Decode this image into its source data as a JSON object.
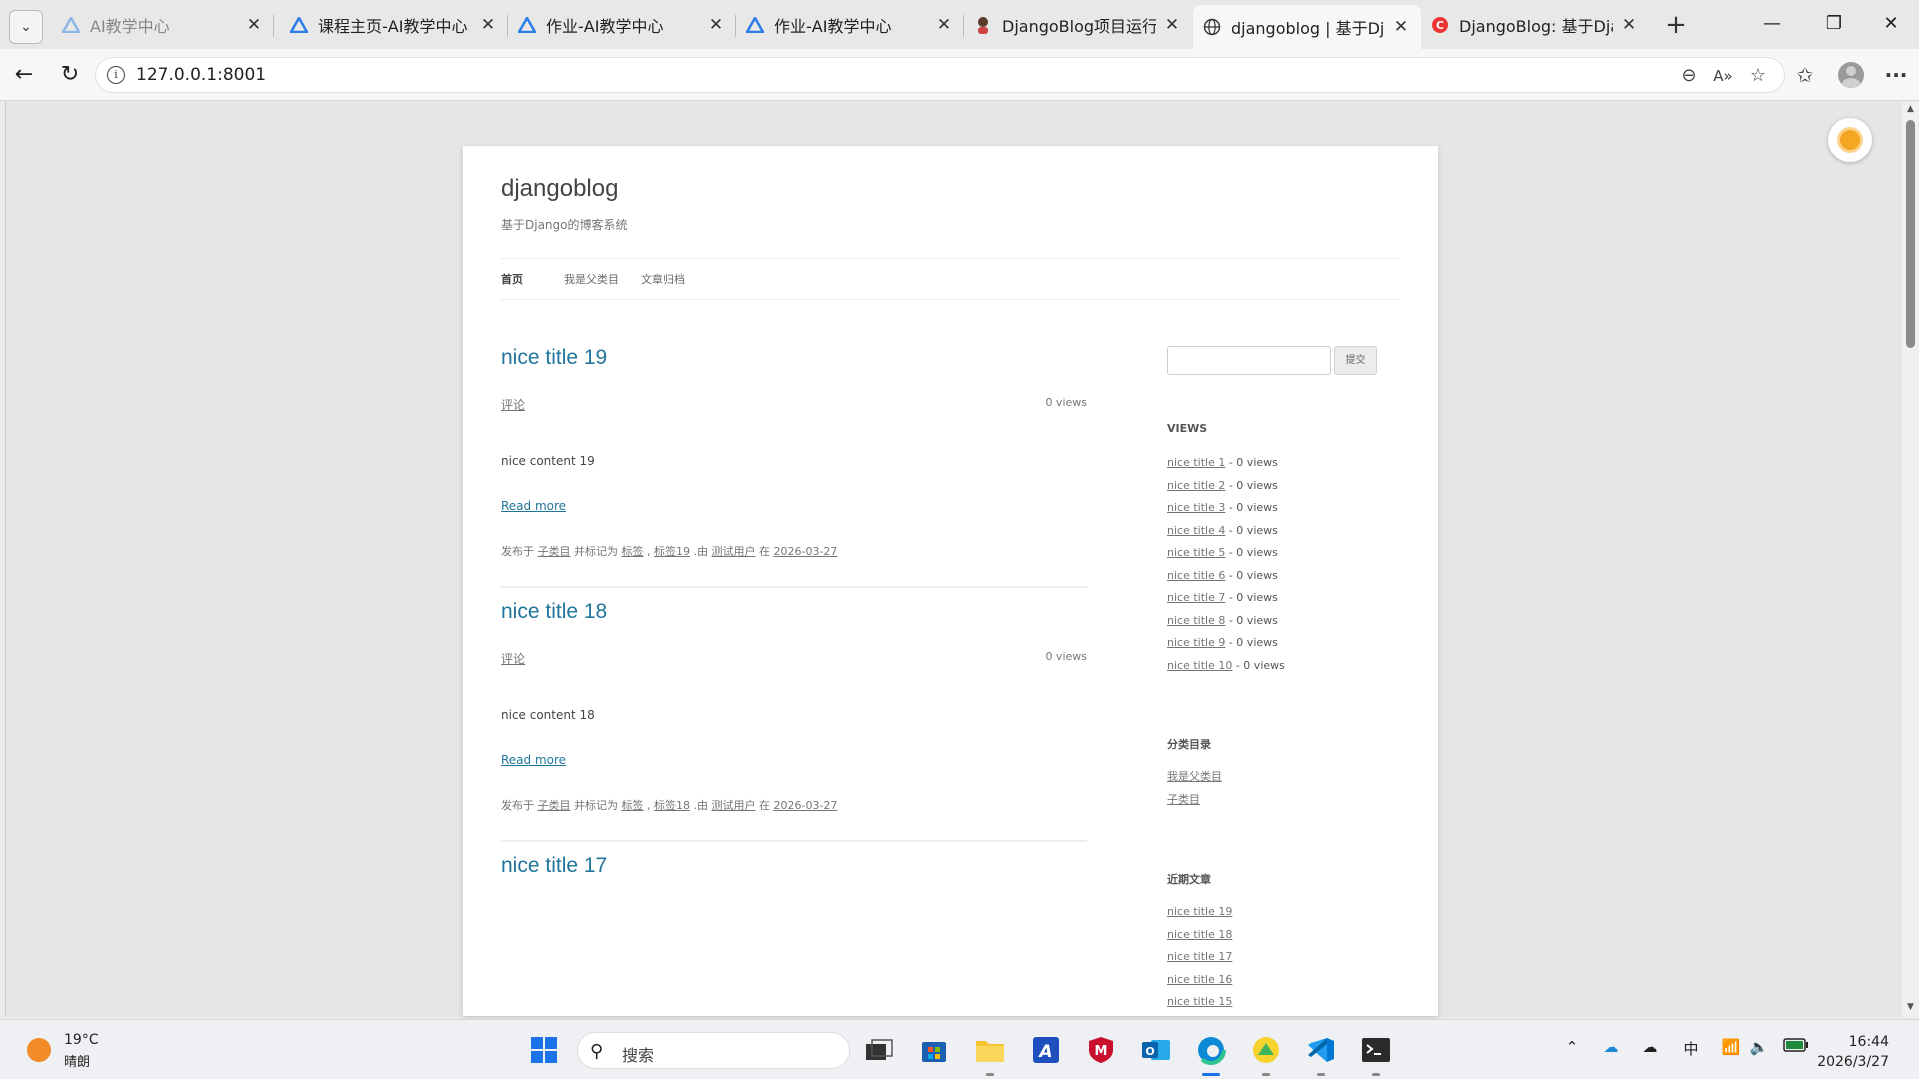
{
  "browser": {
    "tabs": [
      {
        "title": "AI教学中心",
        "dim": true,
        "icon": "ai-logo-icon"
      },
      {
        "title": "课程主页-AI教学中心",
        "icon": "ai-logo-icon"
      },
      {
        "title": "作业-AI教学中心",
        "icon": "ai-logo-icon"
      },
      {
        "title": "作业-AI教学中心",
        "icon": "ai-logo-icon"
      },
      {
        "title": "DjangoBlog项目运行方",
        "icon": "person-favicon-icon"
      },
      {
        "title": "djangoblog | 基于Djang",
        "icon": "globe-icon",
        "active": true
      },
      {
        "title": "DjangoBlog: 基于Djang",
        "icon": "csdn-logo-icon"
      }
    ],
    "url": "127.0.0.1:8001"
  },
  "blog": {
    "site_title": "djangoblog",
    "site_description": "基于Django的博客系统",
    "nav": [
      "首页",
      "我是父类目",
      "文章归档"
    ],
    "posts": [
      {
        "title": "nice title 19",
        "comment": "评论",
        "views": "0 views",
        "content": "nice content 19",
        "read_more": "Read more",
        "meta": {
          "p1": "发布于",
          "category": "子类目",
          "p2": "并标记为",
          "tag1": "标签",
          "sep": ",",
          "tag2": "标签19",
          "p3": ".由",
          "author": "测试用户",
          "p4": "在",
          "date": "2026-03-27"
        }
      },
      {
        "title": "nice title 18",
        "comment": "评论",
        "views": "0 views",
        "content": "nice content 18",
        "read_more": "Read more",
        "meta": {
          "p1": "发布于",
          "category": "子类目",
          "p2": "并标记为",
          "tag1": "标签",
          "sep": ",",
          "tag2": "标签18",
          "p3": ".由",
          "author": "测试用户",
          "p4": "在",
          "date": "2026-03-27"
        }
      },
      {
        "title": "nice title 17"
      }
    ],
    "sidebar": {
      "search_button": "提交",
      "views_title": "VIEWS",
      "views": [
        {
          "title": "nice title 1",
          "count": "- 0 views"
        },
        {
          "title": "nice title 2",
          "count": "- 0 views"
        },
        {
          "title": "nice title 3",
          "count": "- 0 views"
        },
        {
          "title": "nice title 4",
          "count": "- 0 views"
        },
        {
          "title": "nice title 5",
          "count": "- 0 views"
        },
        {
          "title": "nice title 6",
          "count": "- 0 views"
        },
        {
          "title": "nice title 7",
          "count": "- 0 views"
        },
        {
          "title": "nice title 8",
          "count": "- 0 views"
        },
        {
          "title": "nice title 9",
          "count": "- 0 views"
        },
        {
          "title": "nice title 10",
          "count": "- 0 views"
        }
      ],
      "categories_title": "分类目录",
      "categories": [
        "我是父类目",
        "子类目"
      ],
      "recent_title": "近期文章",
      "recent": [
        "nice title 19",
        "nice title 18",
        "nice title 17",
        "nice title 16",
        "nice title 15"
      ]
    }
  },
  "taskbar": {
    "temperature": "19°C",
    "weather": "晴朗",
    "search": "搜索",
    "ime": "中",
    "time": "16:44",
    "date": "2026/3/27"
  }
}
